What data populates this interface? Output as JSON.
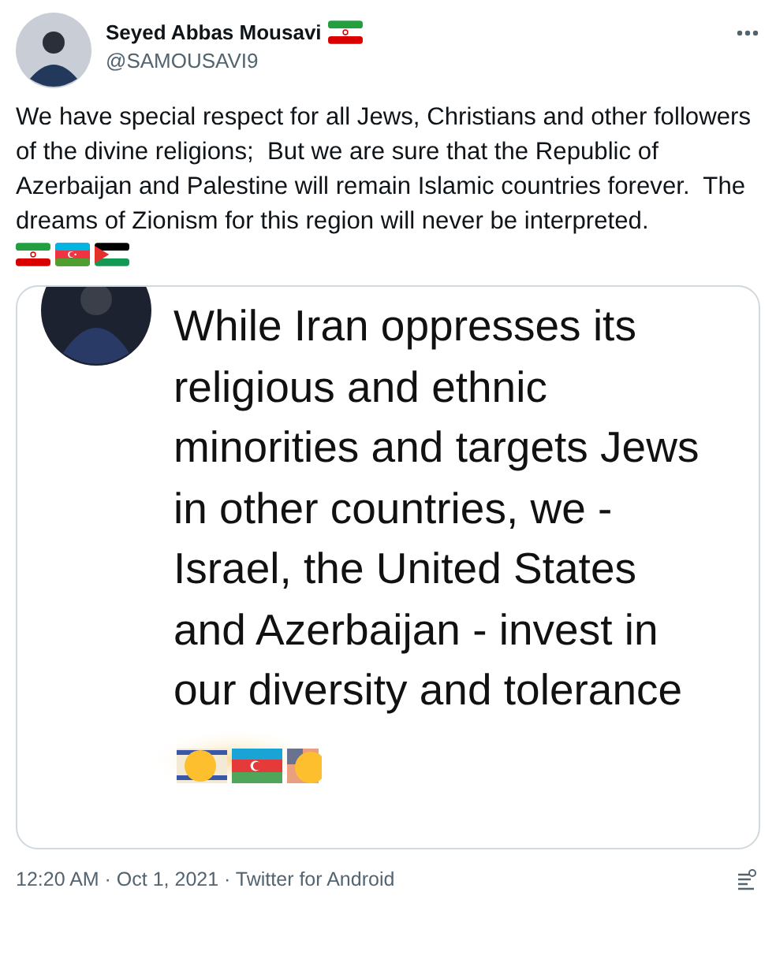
{
  "author": {
    "name": "Seyed Abbas Mousavi",
    "handle": "@SAMOUSAVI9"
  },
  "tweet_text": "We have special respect for all Jews, Christians and other followers of the divine religions;  But we are sure that the Republic of Azerbaijan and Palestine will remain Islamic countries forever.  The dreams of Zionism for this region will never be interpreted.",
  "media": {
    "quoted_text": "While Iran oppresses its\nreligious and ethnic\nminorities and targets Jews\nin other countries, we -\nIsrael, the United States\nand Azerbaijan - invest in\nour diversity and tolerance"
  },
  "footer": {
    "timestamp": "12:20 AM · Oct 1, 2021 · Twitter for Android"
  }
}
